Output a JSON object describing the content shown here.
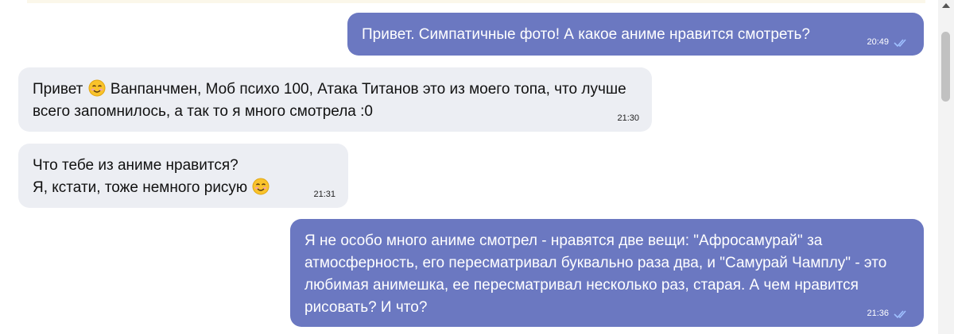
{
  "messages": [
    {
      "direction": "outgoing",
      "text": "Привет. Симпатичные фото! А какое аниме нравится смотреть?",
      "time": "20:49",
      "status": "read"
    },
    {
      "direction": "incoming",
      "text_parts": [
        "Привет ",
        " Ванпанчмен, Моб психо 100, Атака Титанов это из моего топа, что лучше всего запомнилось, а так то я много смотрела :0"
      ],
      "time": "21:30"
    },
    {
      "direction": "incoming",
      "line1": "Что тебе из аниме нравится?",
      "line2": "Я, кстати, тоже немного рисую ",
      "time": "21:31"
    },
    {
      "direction": "outgoing",
      "text": "Я не особо много аниме смотрел - нравятся две вещи: \"Афросамурай\" за атмосферность, его пересматривал буквально раза два, и \"Самурай Champloo\"",
      "text_full": "Я не особо много аниме смотрел - нравятся две вещи: \"Афросамурай\" за атмосферность, его пересматривал буквально раза два, и \"Самурай Чамплу\" - это любимая анимешка, ее пересматривал несколько раз, старая. А чем нравится рисовать? И что?",
      "time": "21:36",
      "status": "read"
    }
  ],
  "icons": {
    "emoji": "smiling-face-emoji",
    "read_status": "double-check-icon"
  },
  "colors": {
    "outgoing_bubble": "#6b78c1",
    "incoming_bubble": "#eceef3",
    "check_color": "#9fc0ff",
    "emoji_yellow": "#f9c32b"
  }
}
